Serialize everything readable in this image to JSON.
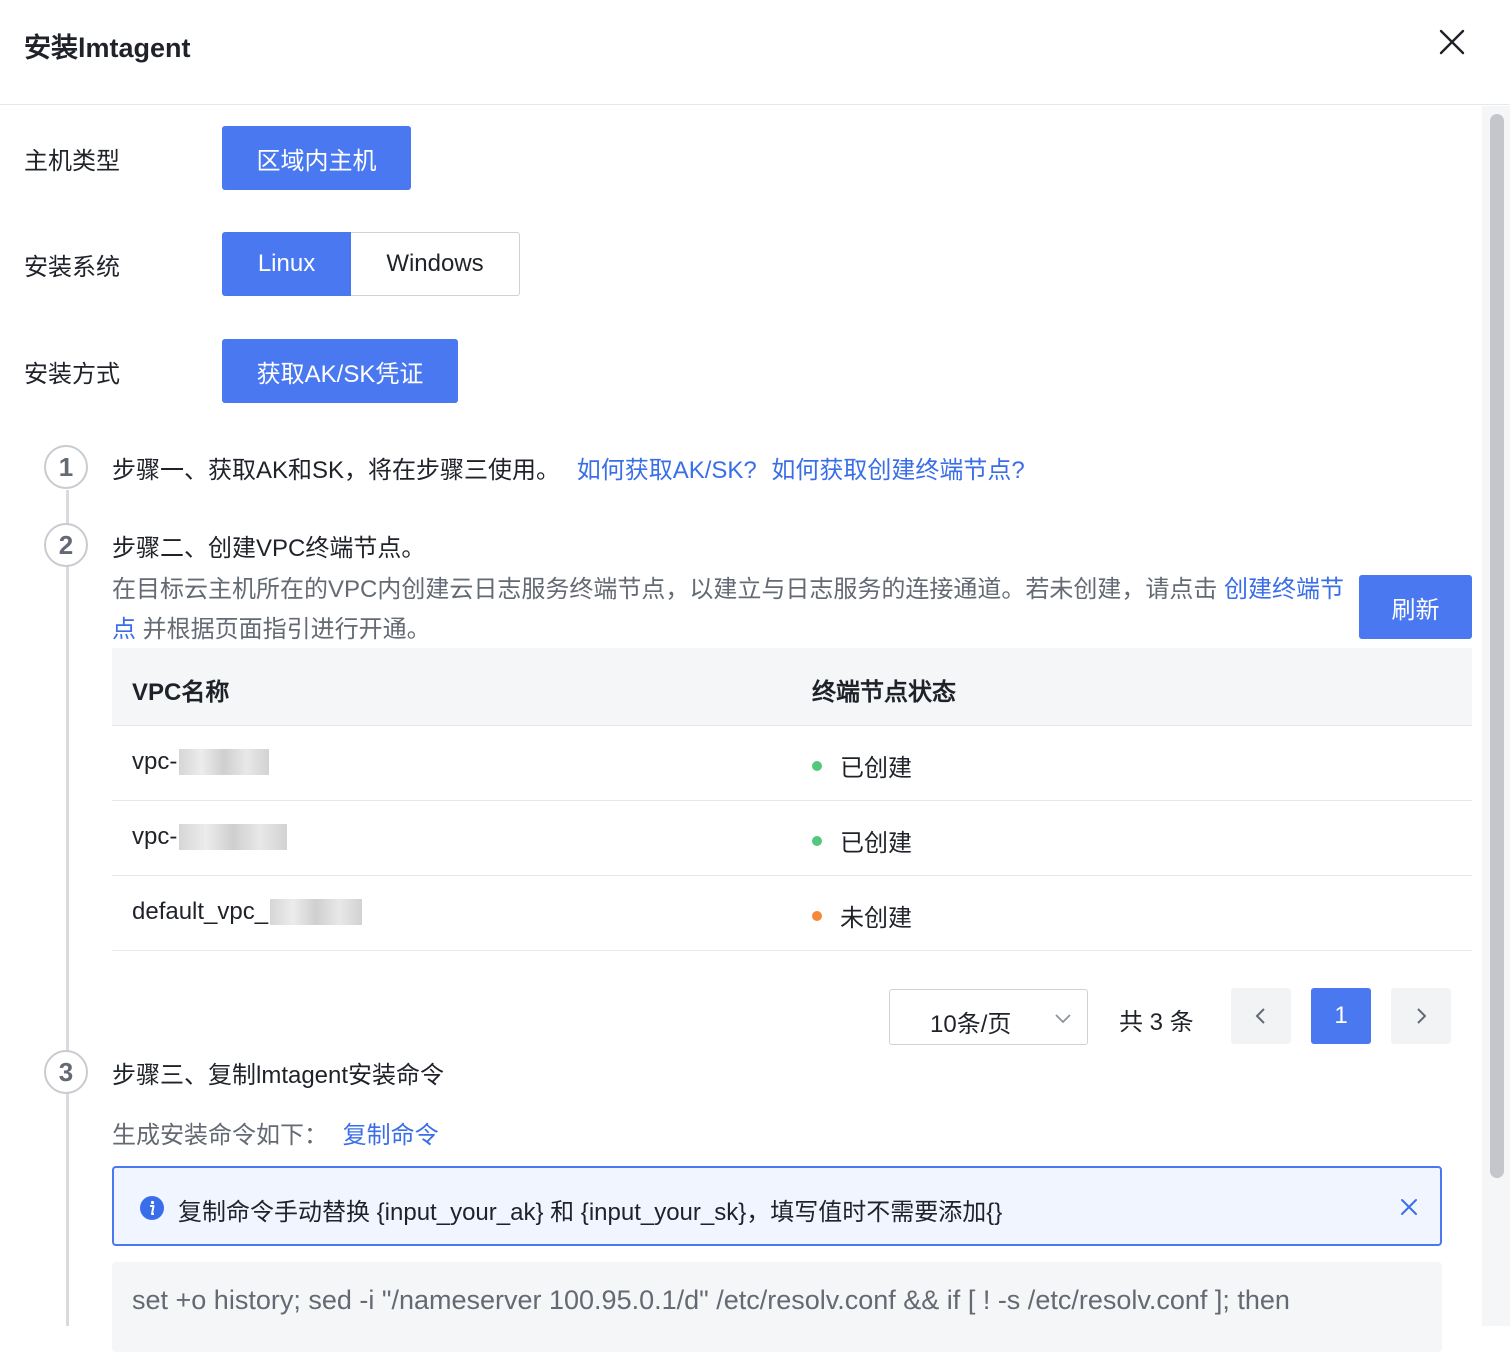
{
  "dialog": {
    "title": "安装lmtagent"
  },
  "form": {
    "host_type": {
      "label": "主机类型",
      "button": "区域内主机"
    },
    "os": {
      "label": "安装系统",
      "options": [
        "Linux",
        "Windows"
      ],
      "selected": "Linux"
    },
    "method": {
      "label": "安装方式",
      "button": "获取AK/SK凭证"
    }
  },
  "steps": {
    "step1": {
      "number": "1",
      "text": "步骤一、获取AK和SK，将在步骤三使用。",
      "link1": "如何获取AK/SK?",
      "link2": "如何获取创建终端节点?"
    },
    "step2": {
      "number": "2",
      "text": "步骤二、创建VPC终端节点。",
      "desc_before": "在目标云主机所在的VPC内创建云日志服务终端节点，以建立与日志服务的连接通道。若未创建，请点击 ",
      "desc_link": "创建终端节点",
      "desc_after": " 并根据页面指引进行开通。",
      "refresh_button": "刷新"
    },
    "step3": {
      "number": "3",
      "text": "步骤三、复制lmtagent安装命令",
      "gen_label": "生成安装命令如下：",
      "copy_link": "复制命令"
    }
  },
  "table": {
    "headers": [
      "VPC名称",
      "终端节点状态"
    ],
    "rows": [
      {
        "name": "vpc-",
        "status": "已创建",
        "status_color": "#52c77d"
      },
      {
        "name": "vpc-",
        "status": "已创建",
        "status_color": "#52c77d"
      },
      {
        "name": "default_vpc_",
        "status": "未创建",
        "status_color": "#f5883a"
      }
    ]
  },
  "pagination": {
    "page_size": "10条/页",
    "total": "共 3 条",
    "current_page": "1"
  },
  "alert": {
    "message": "复制命令手动替换 {input_your_ak} 和 {input_your_sk}，填写值时不需要添加{}"
  },
  "command": {
    "line1": "set +o history; sed -i \"/nameserver 100.95.0.1/d\" /etc/resolv.conf && if [ ! -s /etc/resolv.conf ]; then"
  },
  "colors": {
    "primary": "#4a78f0",
    "link": "#3a6ee8"
  }
}
